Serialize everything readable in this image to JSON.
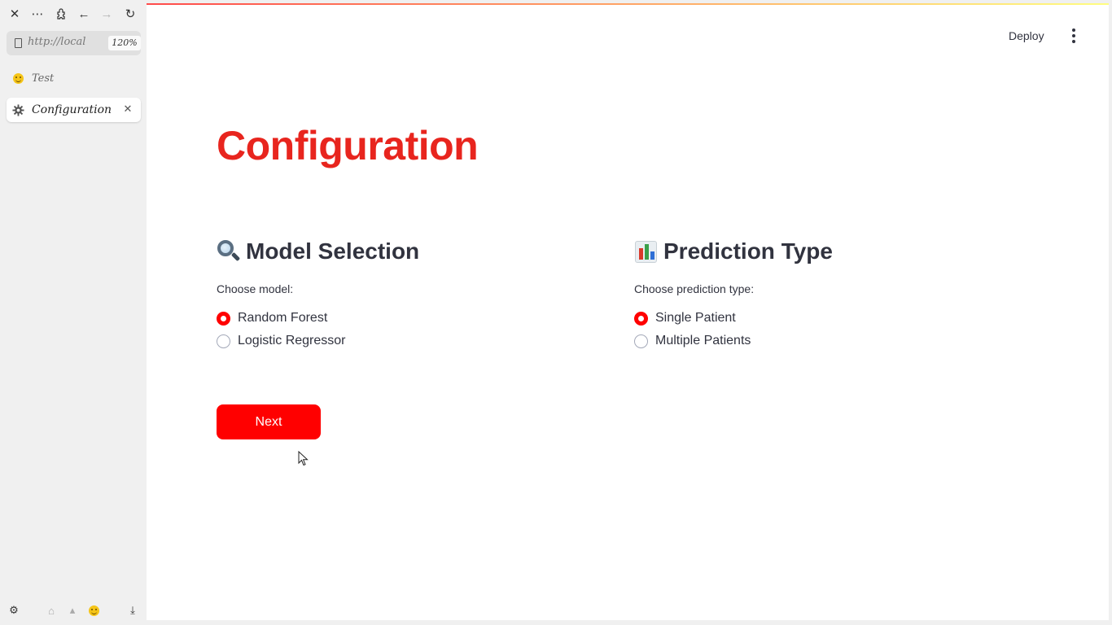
{
  "browser": {
    "url": "http://local",
    "zoom": "120%",
    "tabs": [
      {
        "label": "Test",
        "icon": "smiley-icon",
        "active": false
      },
      {
        "label": "Configuration",
        "icon": "gear-icon",
        "active": true
      }
    ]
  },
  "header": {
    "deploy_label": "Deploy"
  },
  "page": {
    "title": "Configuration",
    "title_color": "#e8251e",
    "accent_color": "#ff0000"
  },
  "model_selection": {
    "heading": "Model Selection",
    "icon": "magnifier-icon",
    "radio_label": "Choose model:",
    "options": [
      "Random Forest",
      "Logistic Regressor"
    ],
    "selected": "Random Forest"
  },
  "prediction_type": {
    "heading": "Prediction Type",
    "icon": "bar-chart-icon",
    "radio_label": "Choose prediction type:",
    "options": [
      "Single Patient",
      "Multiple Patients"
    ],
    "selected": "Single Patient"
  },
  "next_button": {
    "label": "Next"
  }
}
